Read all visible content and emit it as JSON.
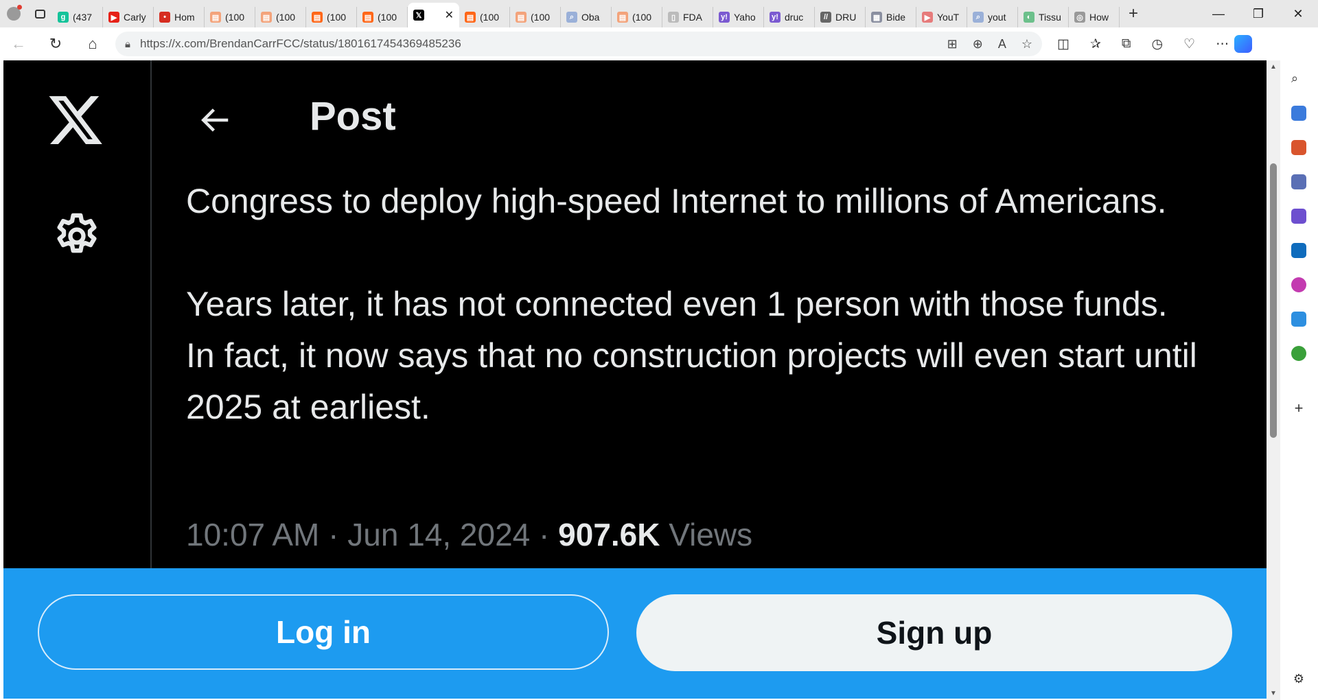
{
  "browser": {
    "tabs": [
      {
        "label": "(437",
        "favicon": "grammarly-icon",
        "color": "#15c39a",
        "glyph": "g"
      },
      {
        "label": "Carly",
        "favicon": "youtube-icon",
        "color": "#e62117",
        "glyph": "▶"
      },
      {
        "label": "Hom",
        "favicon": "location-pin-icon",
        "color": "#d62d20",
        "glyph": "•"
      },
      {
        "label": "(100",
        "favicon": "substack-icon",
        "color": "#f3a37b",
        "glyph": "▤"
      },
      {
        "label": "(100",
        "favicon": "substack-icon",
        "color": "#f3a37b",
        "glyph": "▤"
      },
      {
        "label": "(100",
        "favicon": "substack-icon",
        "color": "#ff6719",
        "glyph": "▤"
      },
      {
        "label": "(100",
        "favicon": "substack-icon",
        "color": "#ff6719",
        "glyph": "▤"
      },
      {
        "label": "",
        "favicon": "x-icon",
        "color": "#000000",
        "glyph": "𝕏",
        "active": true
      },
      {
        "label": "(100",
        "favicon": "substack-icon",
        "color": "#ff6719",
        "glyph": "▤"
      },
      {
        "label": "(100",
        "favicon": "substack-icon",
        "color": "#f3a37b",
        "glyph": "▤"
      },
      {
        "label": "Oba",
        "favicon": "search-icon",
        "color": "#9ab0d8",
        "glyph": "⌕"
      },
      {
        "label": "(100",
        "favicon": "substack-icon",
        "color": "#f3a37b",
        "glyph": "▤"
      },
      {
        "label": "FDA",
        "favicon": "document-icon",
        "color": "#bbbbbb",
        "glyph": "▯"
      },
      {
        "label": "Yaho",
        "favicon": "yahoo-icon",
        "color": "#7b5ad1",
        "glyph": "y!"
      },
      {
        "label": "druc",
        "favicon": "yahoo-icon",
        "color": "#7b5ad1",
        "glyph": "y!"
      },
      {
        "label": "DRU",
        "favicon": "drudge-icon",
        "color": "#666666",
        "glyph": "//"
      },
      {
        "label": "Bide",
        "favicon": "news-icon",
        "color": "#8a8fa0",
        "glyph": "▦"
      },
      {
        "label": "YouT",
        "favicon": "youtube-icon",
        "color": "#e67b7b",
        "glyph": "▶"
      },
      {
        "label": "yout",
        "favicon": "search-icon",
        "color": "#9ab0d8",
        "glyph": "⌕"
      },
      {
        "label": "Tissu",
        "favicon": "leaf-icon",
        "color": "#6cc08b",
        "glyph": "◐"
      },
      {
        "label": "How",
        "favicon": "globe-icon",
        "color": "#999999",
        "glyph": "◎"
      }
    ],
    "url": "https://x.com/BrendanCarrFCC/status/1801617454369485236"
  },
  "page": {
    "title": "Post",
    "tweet_paragraphs": [
      "Congress to deploy high-speed Internet to millions of Americans.",
      "Years later, it has not connected even 1 person with those funds. In fact, it now says that no construction projects will even start until 2025 at earliest."
    ],
    "time": "10:07 AM",
    "separator": "·",
    "date": "Jun 14, 2024",
    "views_count": "907.6K",
    "views_label": "Views",
    "login_label": "Log in",
    "signup_label": "Sign up"
  },
  "colors": {
    "background": "#000000",
    "text": "#e7e9ea",
    "muted": "#71767b",
    "accent": "#1d9bf0"
  }
}
